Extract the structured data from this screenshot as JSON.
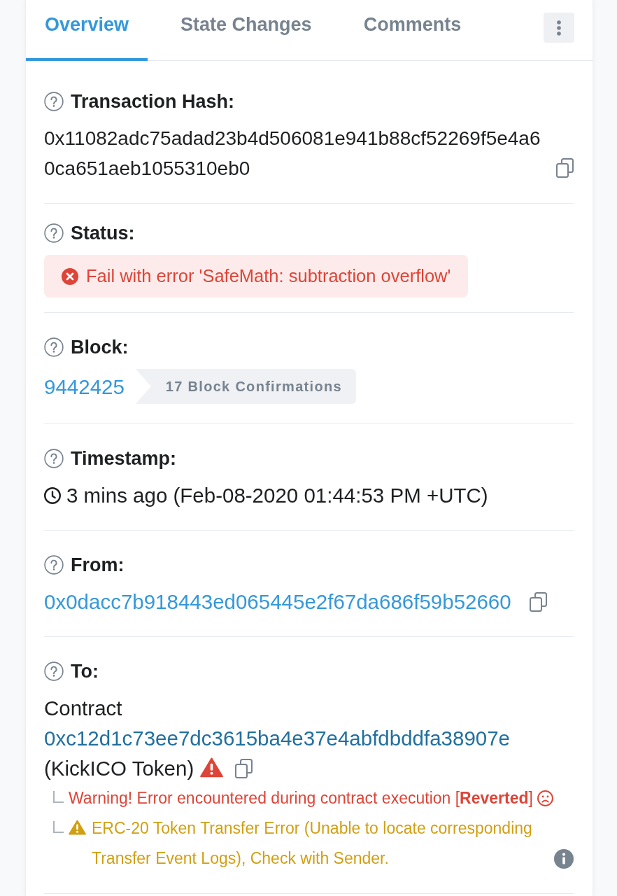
{
  "tabs": [
    {
      "label": "Overview",
      "selected": true
    },
    {
      "label": "State Changes",
      "selected": false
    },
    {
      "label": "Comments",
      "selected": false
    }
  ],
  "sections": [
    {
      "kind": "hash",
      "label": "Transaction Hash:",
      "value": "0x11082adc75adad23b4d506081e941b88cf52269f5e4a60ca651aeb1055310eb0"
    },
    {
      "kind": "status",
      "label": "Status:",
      "status": {
        "kind": "error",
        "text": "Fail with error 'SafeMath: subtraction overflow'"
      }
    },
    {
      "kind": "block",
      "label": "Block:",
      "block_number": "9442425",
      "confirmations": "17 Block Confirmations"
    },
    {
      "kind": "timestamp",
      "label": "Timestamp:",
      "value": "3 mins ago (Feb-08-2020 01:44:53 PM +UTC)"
    },
    {
      "kind": "address",
      "label": "From:",
      "address": "0x0dacc7b918443ed065445e2f67da686f59b52660"
    },
    {
      "kind": "contract",
      "label": "To:",
      "prefix": "Contract",
      "address": "0xc12d1c73ee7dc3615ba4e37e4abfdbddfa38907e",
      "name": "(KickICO Token)",
      "has_error": true,
      "notes": [
        {
          "kind": "error",
          "text": "Warning! Error encountered during contract execution [**Reverted**]"
        },
        {
          "kind": "warning",
          "text": "ERC-20 Token Transfer Error (Unable to locate corresponding Transfer Event Logs), Check with Sender."
        }
      ]
    }
  ]
}
